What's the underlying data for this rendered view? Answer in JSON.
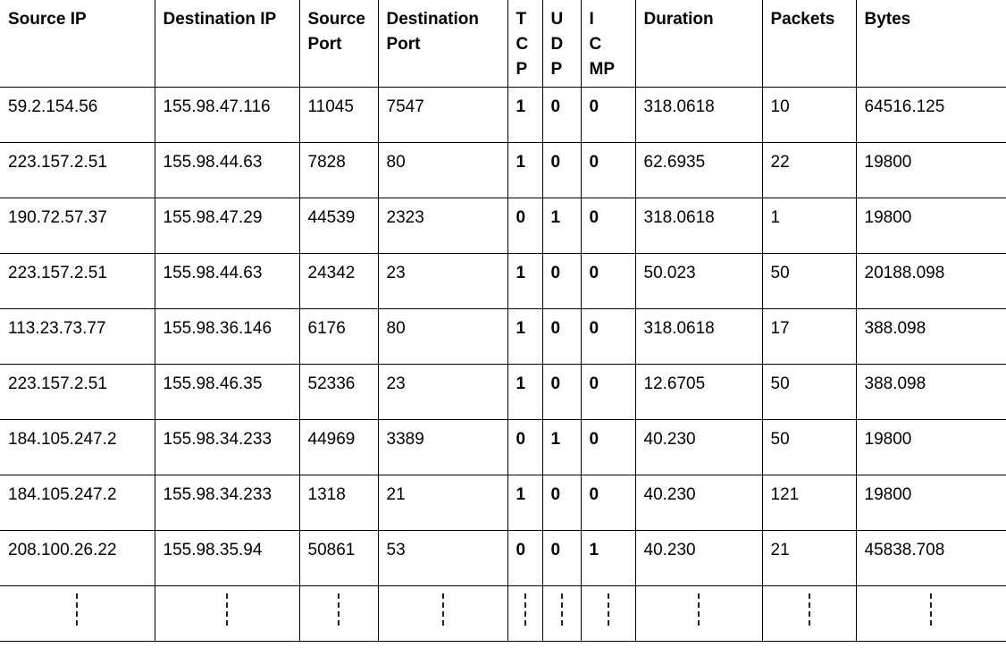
{
  "headers": [
    {
      "lines": [
        "Source IP"
      ]
    },
    {
      "lines": [
        "Destination IP"
      ]
    },
    {
      "lines": [
        "Source",
        "Port"
      ]
    },
    {
      "lines": [
        "Destination",
        "Port"
      ]
    },
    {
      "lines": [
        "T",
        "C",
        "P"
      ]
    },
    {
      "lines": [
        "U",
        "D",
        "P"
      ]
    },
    {
      "lines": [
        "I",
        "C",
        "MP"
      ]
    },
    {
      "lines": [
        "Duration"
      ]
    },
    {
      "lines": [
        "Packets"
      ]
    },
    {
      "lines": [
        "Bytes"
      ]
    }
  ],
  "rows": [
    [
      "59.2.154.56",
      "155.98.47.116",
      "11045",
      "7547",
      "1",
      "0",
      "0",
      "318.0618",
      "10",
      "64516.125"
    ],
    [
      "223.157.2.51",
      "155.98.44.63",
      "7828",
      "80",
      "1",
      "0",
      "0",
      "62.6935",
      "22",
      "19800"
    ],
    [
      "190.72.57.37",
      "155.98.47.29",
      "44539",
      "2323",
      "0",
      "1",
      "0",
      "318.0618",
      "1",
      "19800"
    ],
    [
      "223.157.2.51",
      "155.98.44.63",
      "24342",
      "23",
      "1",
      "0",
      "0",
      "50.023",
      "50",
      "20188.098"
    ],
    [
      "113.23.73.77",
      "155.98.36.146",
      "6176",
      "80",
      "1",
      "0",
      "0",
      "318.0618",
      "17",
      "388.098"
    ],
    [
      "223.157.2.51",
      "155.98.46.35",
      "52336",
      "23",
      "1",
      "0",
      "0",
      "12.6705",
      "50",
      "388.098"
    ],
    [
      "184.105.247.2",
      "155.98.34.233",
      "44969",
      "3389",
      "0",
      "1",
      "0",
      "40.230",
      "50",
      "19800"
    ],
    [
      "184.105.247.2",
      "155.98.34.233",
      "1318",
      "21",
      "1",
      "0",
      "0",
      "40.230",
      "121",
      "19800"
    ],
    [
      "208.100.26.22",
      "155.98.35.94",
      "50861",
      "53",
      "0",
      "0",
      "1",
      "40.230",
      "21",
      "45838.708"
    ]
  ]
}
